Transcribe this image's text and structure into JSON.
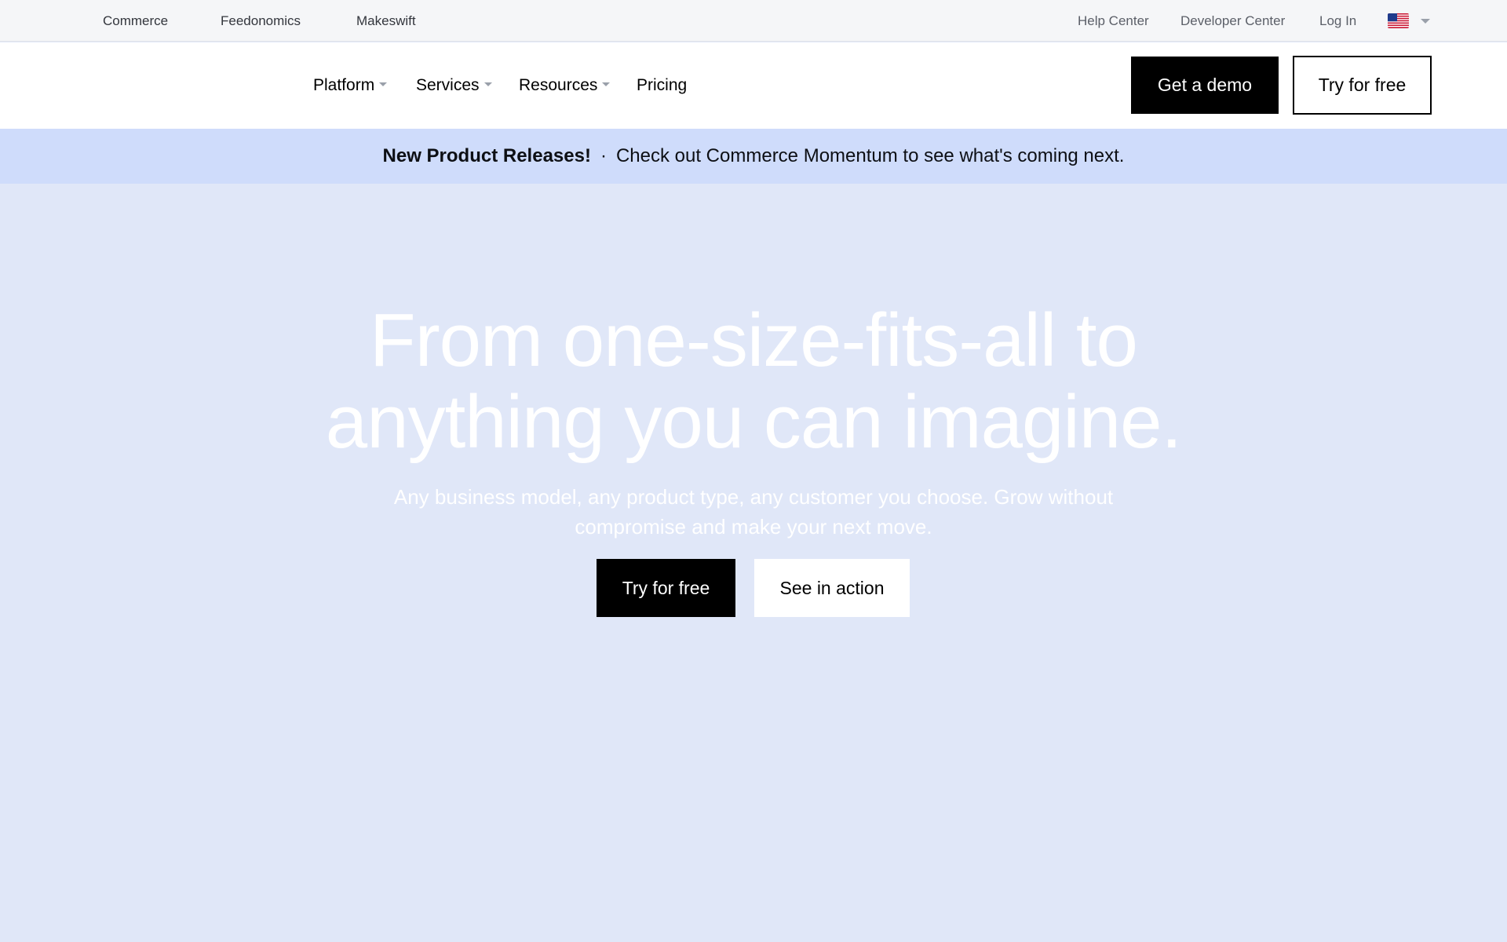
{
  "utility_bar": {
    "brands": [
      "Commerce",
      "Feedonomics",
      "Makeswift"
    ],
    "links": [
      "Help Center",
      "Developer Center",
      "Log In"
    ],
    "locale_icon": "us-flag-icon"
  },
  "nav": {
    "items": [
      {
        "label": "Platform",
        "has_dropdown": true
      },
      {
        "label": "Services",
        "has_dropdown": true
      },
      {
        "label": "Resources",
        "has_dropdown": true
      },
      {
        "label": "Pricing",
        "has_dropdown": false
      }
    ],
    "demo_label": "Get a demo",
    "trial_label": "Try for free"
  },
  "announcement": {
    "headline": "New Product Releases!",
    "separator": "·",
    "message": "Check out Commerce Momentum to see what's coming next."
  },
  "hero": {
    "title_line1": "From one-size-fits-all to",
    "title_line2": "anything you can imagine.",
    "subtitle": "Any business model, any product type, any customer you choose. Grow without compromise and make your next move.",
    "primary_label": "Try for free",
    "secondary_label": "See in action"
  },
  "colors": {
    "utility_bg": "#f5f6f8",
    "announce_bg": "#cfdcfb",
    "hero_bg": "#e0e7f8",
    "button_dark": "#000000"
  }
}
